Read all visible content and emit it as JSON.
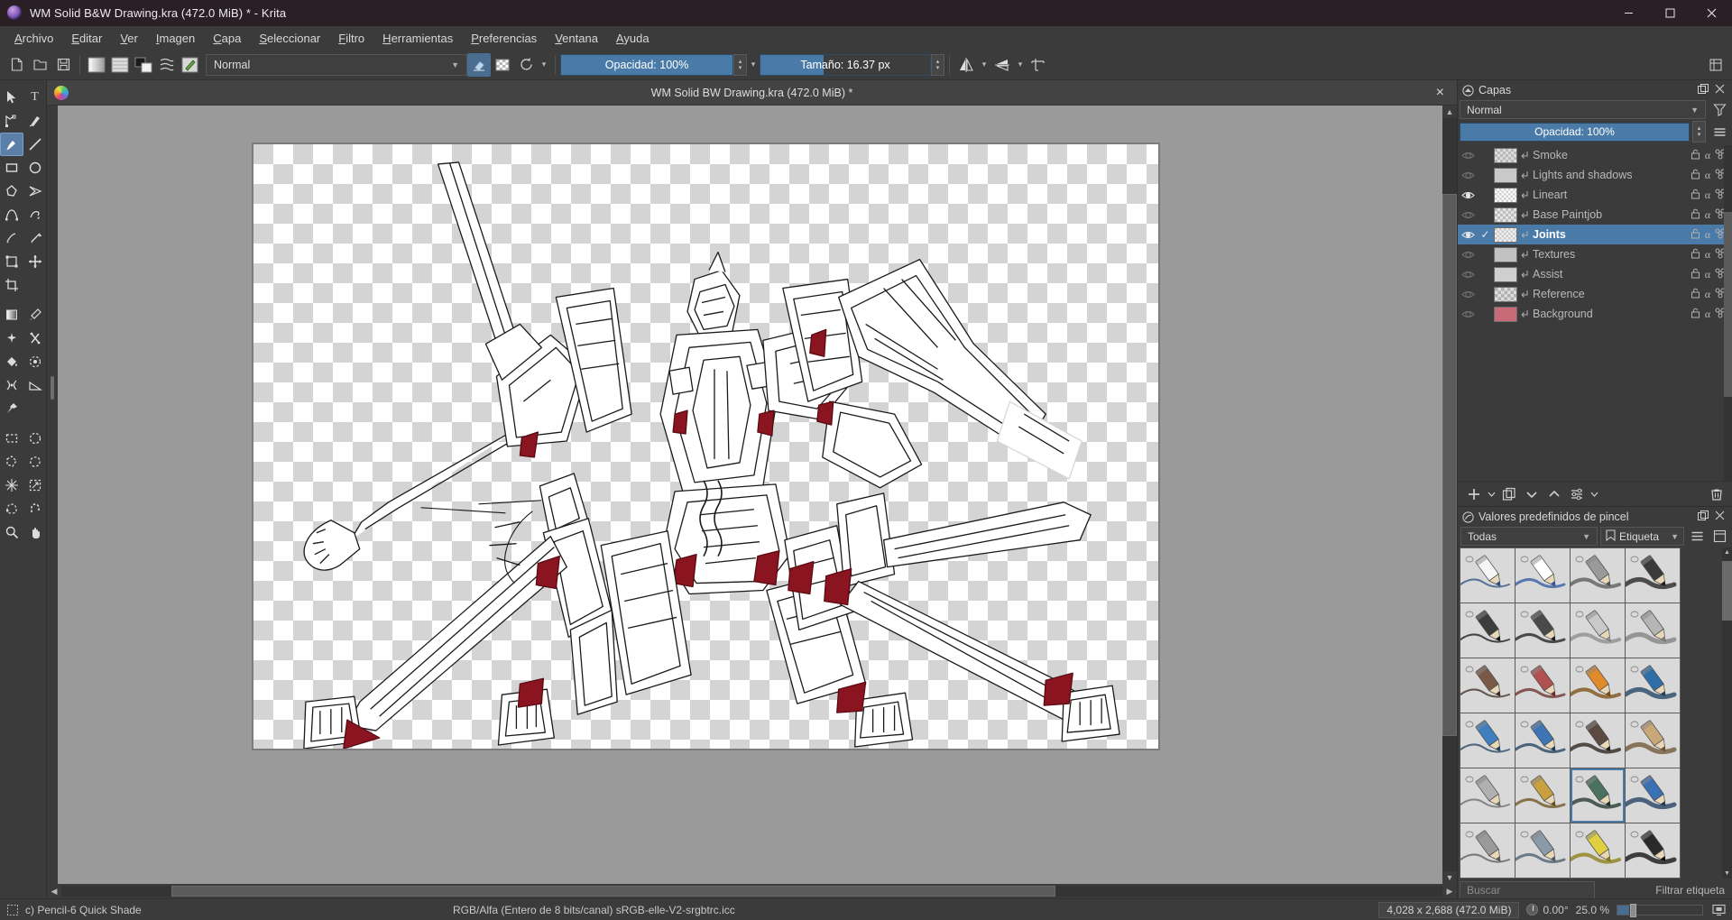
{
  "window": {
    "title": "WM Solid B&W Drawing.kra (472.0 MiB) * - Krita",
    "app_icon": "krita-logo-icon",
    "minimize_label": "Minimizar",
    "maximize_label": "Maximizar",
    "close_label": "Cerrar"
  },
  "menubar": {
    "items": [
      {
        "label": "Archivo"
      },
      {
        "label": "Editar"
      },
      {
        "label": "Ver"
      },
      {
        "label": "Imagen"
      },
      {
        "label": "Capa"
      },
      {
        "label": "Seleccionar"
      },
      {
        "label": "Filtro"
      },
      {
        "label": "Herramientas"
      },
      {
        "label": "Preferencias"
      },
      {
        "label": "Ventana"
      },
      {
        "label": "Ayuda"
      }
    ]
  },
  "toolbar": {
    "buttons": [
      {
        "name": "new-file-icon"
      },
      {
        "name": "open-file-icon"
      },
      {
        "name": "save-file-icon"
      },
      {
        "name": "gradient-icon"
      },
      {
        "name": "pattern-icon"
      },
      {
        "name": "fg-bg-color-icon"
      },
      {
        "name": "brush-presets-icon"
      },
      {
        "name": "brush-editor-icon"
      }
    ],
    "blend_mode": "Normal",
    "eraser_icon": "eraser-icon",
    "preserve_alpha_icon": "preserve-alpha-icon",
    "reload_icon": "reload-preset-icon",
    "opacity_label": "Opacidad: 100%",
    "opacity_value": 100,
    "size_label": "Tamaño: 16.37 px",
    "size_value": 16.37,
    "mirror_h_icon": "mirror-horizontal-icon",
    "mirror_v_icon": "mirror-vertical-icon",
    "wrap_icon": "wrap-around-icon",
    "hamburger_icon": "toolbar-overflow-icon"
  },
  "toolbox": {
    "tools": [
      {
        "name": "select-shapes-tool",
        "glyph": "arrow"
      },
      {
        "name": "text-tool",
        "glyph": "T"
      },
      {
        "name": "edit-shapes-tool",
        "glyph": "node"
      },
      {
        "name": "calligraphy-tool",
        "glyph": "calligraphy"
      },
      {
        "name": "freehand-brush-tool",
        "glyph": "brush",
        "active": true
      },
      {
        "name": "line-tool",
        "glyph": "line"
      },
      {
        "name": "rectangle-tool",
        "glyph": "rect"
      },
      {
        "name": "ellipse-tool",
        "glyph": "ellipse"
      },
      {
        "name": "polygon-tool",
        "glyph": "polygon"
      },
      {
        "name": "polyline-tool",
        "glyph": "polyline"
      },
      {
        "name": "bezier-curve-tool",
        "glyph": "bezier"
      },
      {
        "name": "freehand-path-tool",
        "glyph": "freepath"
      },
      {
        "name": "dynamic-brush-tool",
        "glyph": "dynbrush"
      },
      {
        "name": "multibrush-tool",
        "glyph": "multibrush"
      },
      {
        "name": "transform-tool",
        "glyph": "transform"
      },
      {
        "name": "move-tool",
        "glyph": "move"
      },
      {
        "name": "crop-tool",
        "glyph": "crop"
      },
      {
        "name": "gradient-tool",
        "glyph": "gradient"
      },
      {
        "name": "color-sampler-tool",
        "glyph": "dropper"
      },
      {
        "name": "colorize-mask-tool",
        "glyph": "colorize"
      },
      {
        "name": "smart-patch-tool",
        "glyph": "patch"
      },
      {
        "name": "fill-tool",
        "glyph": "fill"
      },
      {
        "name": "enclose-fill-tool",
        "glyph": "enclose"
      },
      {
        "name": "assistant-tool",
        "glyph": "assistant"
      },
      {
        "name": "measure-tool",
        "glyph": "measure"
      },
      {
        "name": "reference-images-tool",
        "glyph": "pin"
      },
      {
        "name": "rectangular-selection-tool",
        "glyph": "sel-rect"
      },
      {
        "name": "elliptical-selection-tool",
        "glyph": "sel-ellipse"
      },
      {
        "name": "polygonal-selection-tool",
        "glyph": "sel-poly"
      },
      {
        "name": "freehand-selection-tool",
        "glyph": "sel-free"
      },
      {
        "name": "contiguous-selection-tool",
        "glyph": "sel-contig"
      },
      {
        "name": "similar-color-selection-tool",
        "glyph": "sel-similar"
      },
      {
        "name": "bezier-selection-tool",
        "glyph": "sel-bezier"
      },
      {
        "name": "magnetic-selection-tool",
        "glyph": "sel-magnetic"
      },
      {
        "name": "zoom-tool",
        "glyph": "zoom"
      },
      {
        "name": "pan-tool",
        "glyph": "pan"
      }
    ]
  },
  "canvas": {
    "tab_title": "WM Solid BW Drawing.kra (472.0 MiB) *",
    "close_label": "×",
    "artwork_alt": "Mecha lineart drawing on transparent checkerboard background"
  },
  "layers_docker": {
    "title": "Capas",
    "icon": "layers-docker-icon",
    "float_label": "Desacoplar",
    "close_label": "Cerrar",
    "blend_mode": "Normal",
    "filter_icon": "filter-layers-icon",
    "menu_icon": "layers-menu-icon",
    "opacity_label": "Opacidad: 100%",
    "opacity_value": 100,
    "layers": [
      {
        "name": "Smoke",
        "visible": false,
        "selected": false,
        "checked": false,
        "inherit_alpha": true
      },
      {
        "name": "Lights and shadows",
        "visible": false,
        "selected": false,
        "checked": false,
        "inherit_alpha": true
      },
      {
        "name": "Lineart",
        "visible": true,
        "selected": false,
        "checked": false,
        "inherit_alpha": true
      },
      {
        "name": "Base Paintjob",
        "visible": false,
        "selected": false,
        "checked": false,
        "inherit_alpha": true
      },
      {
        "name": "Joints",
        "visible": true,
        "selected": true,
        "checked": true,
        "inherit_alpha": true
      },
      {
        "name": "Textures",
        "visible": false,
        "selected": false,
        "checked": false,
        "inherit_alpha": true
      },
      {
        "name": "Assist",
        "visible": false,
        "selected": false,
        "checked": false,
        "inherit_alpha": true
      },
      {
        "name": "Reference",
        "visible": false,
        "selected": false,
        "checked": false,
        "inherit_alpha": true
      },
      {
        "name": "Background",
        "visible": false,
        "selected": false,
        "checked": false,
        "inherit_alpha": true
      }
    ],
    "toolbar_buttons": [
      {
        "name": "add-layer-button",
        "glyph": "plus"
      },
      {
        "name": "add-layer-dropdown",
        "glyph": "caret"
      },
      {
        "name": "duplicate-layer-button",
        "glyph": "duplicate"
      },
      {
        "name": "move-layer-down-button",
        "glyph": "chev-down"
      },
      {
        "name": "move-layer-up-button",
        "glyph": "chev-up"
      },
      {
        "name": "layer-properties-button",
        "glyph": "properties"
      },
      {
        "name": "layer-properties-dropdown",
        "glyph": "caret"
      },
      {
        "name": "delete-layer-button",
        "glyph": "trash"
      }
    ]
  },
  "brush_docker": {
    "title": "Valores predefinidos de pincel",
    "icon": "brush-presets-docker-icon",
    "float_label": "Desacoplar",
    "close_label": "Cerrar",
    "collection": "Todas",
    "tag_label": "Etiqueta",
    "tag_icon": "tag-icon",
    "list-view_icon": "list-view-icon",
    "detail-view_icon": "detail-view-icon",
    "search_placeholder": "Buscar",
    "search_value": "",
    "filter_tag_label": "Filtrar etiqueta",
    "selected_index": 18,
    "presets": [
      {
        "kind": "eraser-soft",
        "c1": "#f5f5f5",
        "c2": "#2b4f85"
      },
      {
        "kind": "eraser-small",
        "c1": "#ffffff",
        "c2": "#2f57a0"
      },
      {
        "kind": "airbrush-soft",
        "c1": "#9a9a9a",
        "c2": "#555555"
      },
      {
        "kind": "airbrush-dark",
        "c1": "#3a3a3a",
        "c2": "#1c1c1c"
      },
      {
        "kind": "ink-dark",
        "c1": "#3d3d3d",
        "c2": "#141414"
      },
      {
        "kind": "ink-smooth",
        "c1": "#4a4a4a",
        "c2": "#1a1a1a"
      },
      {
        "kind": "ink-light",
        "c1": "#c9c9c9",
        "c2": "#8a8a8a"
      },
      {
        "kind": "ink-fade",
        "c1": "#b5b5b5",
        "c2": "#7d7d7d"
      },
      {
        "kind": "pen-brown",
        "c1": "#7a5a46",
        "c2": "#3a2a20"
      },
      {
        "kind": "pen-red",
        "c1": "#b05050",
        "c2": "#6a2a2a"
      },
      {
        "kind": "pencil-orange",
        "c1": "#e08a2a",
        "c2": "#7a4a10"
      },
      {
        "kind": "pencil-blue",
        "c1": "#2f6fa8",
        "c2": "#1a3f60"
      },
      {
        "kind": "pencil-blue-2",
        "c1": "#3f7fc0",
        "c2": "#204060"
      },
      {
        "kind": "pencil-blue-3",
        "c1": "#3c74b4",
        "c2": "#1e3c5a"
      },
      {
        "kind": "pencil-dark",
        "c1": "#5a4a42",
        "c2": "#241c18"
      },
      {
        "kind": "pencil-tan",
        "c1": "#c8a878",
        "c2": "#6a5230"
      },
      {
        "kind": "marker-grey",
        "c1": "#b0b0b0",
        "c2": "#6a6a6a"
      },
      {
        "kind": "pencil-gold",
        "c1": "#c8a040",
        "c2": "#6a5018"
      },
      {
        "kind": "quick-shade",
        "c1": "#4a7060",
        "c2": "#1c3028"
      },
      {
        "kind": "hatch-blue",
        "c1": "#3a70b4",
        "c2": "#1c3a5c"
      },
      {
        "kind": "pen-grey",
        "c1": "#9a9a9a",
        "c2": "#5a5a5a"
      },
      {
        "kind": "pen-steel",
        "c1": "#8a9aa8",
        "c2": "#4a5a68"
      },
      {
        "kind": "marker-yellow",
        "c1": "#e0d040",
        "c2": "#8a7a10"
      },
      {
        "kind": "ink-black",
        "c1": "#2a2a2a",
        "c2": "#0a0a0a"
      }
    ]
  },
  "statusbar": {
    "selection_icon": "selection-mask-icon",
    "current_brush": "c) Pencil-6 Quick Shade",
    "color_profile": "RGB/Alfa (Entero de 8 bits/canal)  sRGB-elle-V2-srgbtrc.icc",
    "image_size": "4,028 x 2,688 (472.0 MiB)",
    "rotation": "0.00°",
    "rotation_icon": "canvas-rotation-icon",
    "zoom": "25.0 %",
    "zoom_value": 25,
    "fit_icon": "fit-to-screen-icon"
  },
  "colors": {
    "accent": "#4a7ba8",
    "titlebar_bg": "#2b1f26",
    "chrome_bg": "#3b3b3b",
    "canvas_bg": "#9a9a9a",
    "text": "#d6d6d6"
  }
}
